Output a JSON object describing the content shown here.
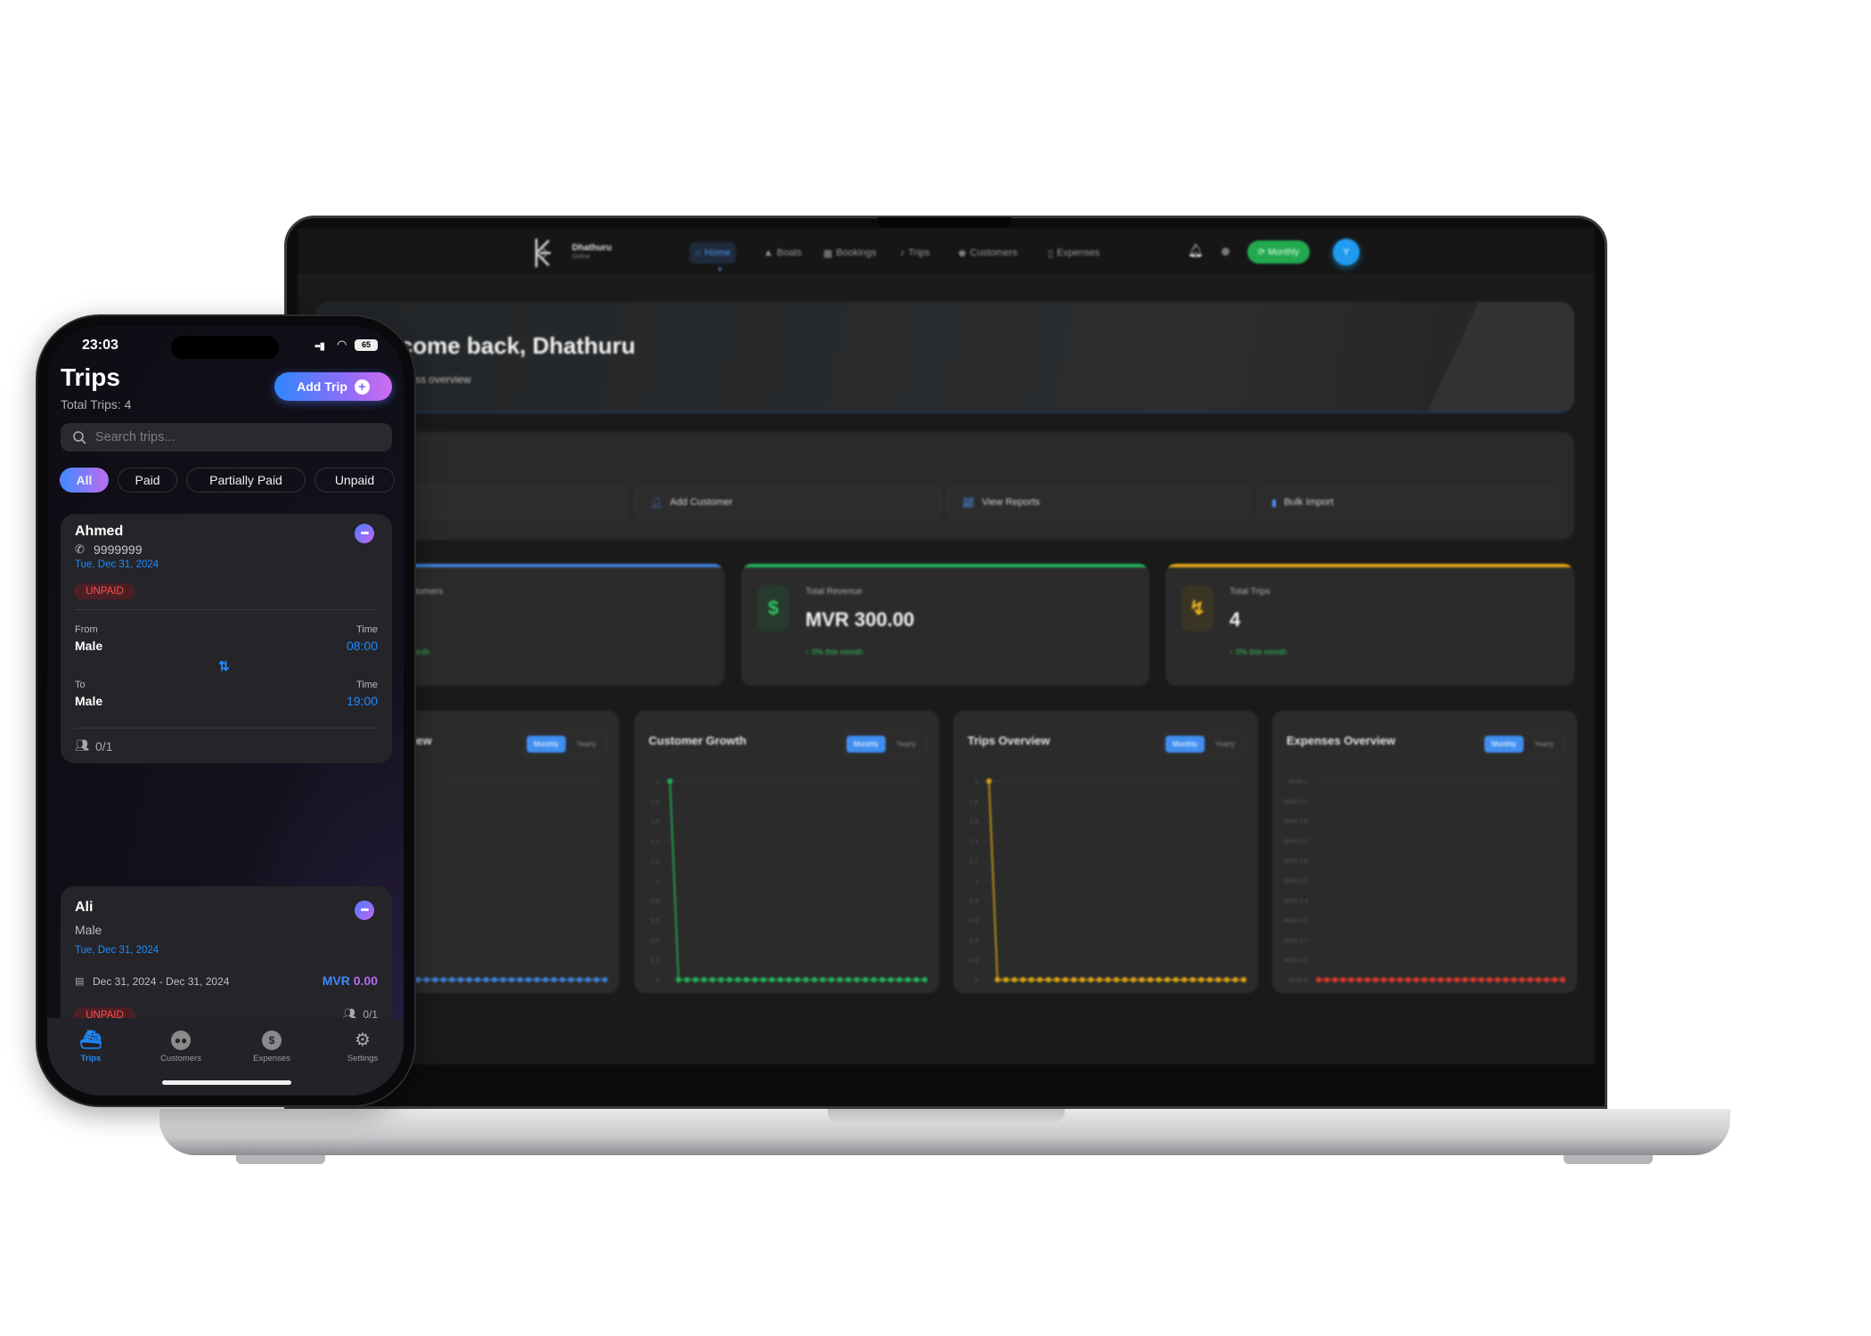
{
  "laptop": {
    "brand": {
      "name": "Dhathuru",
      "sub": "Online"
    },
    "nav": [
      {
        "label": "Home",
        "icon": "home-icon",
        "active": true
      },
      {
        "label": "Boats",
        "icon": "boat-icon"
      },
      {
        "label": "Bookings",
        "icon": "calendar-icon"
      },
      {
        "label": "Trips",
        "icon": "route-icon"
      },
      {
        "label": "Customers",
        "icon": "users-icon"
      },
      {
        "label": "Expenses",
        "icon": "receipt-icon"
      }
    ],
    "header": {
      "period_label": "Monthly",
      "avatar_initial": "Y"
    },
    "welcome": {
      "title": "Welcome back, Dhathuru",
      "subtitle": "Your business overview"
    },
    "quick_actions": [
      {
        "label": "Add Customer",
        "icon": "user-plus-icon"
      },
      {
        "label": "View Reports",
        "icon": "chart-icon"
      },
      {
        "label": "Bulk Import",
        "icon": "file-icon"
      }
    ],
    "stats": [
      {
        "label": "Total Customers",
        "value": "",
        "change": "0% this month",
        "color": "#3f7fd8"
      },
      {
        "label": "Total Revenue",
        "value": "MVR 300.00",
        "change": "↑ 0% this month",
        "color": "#22b357",
        "icon": "dollar-icon"
      },
      {
        "label": "Total Trips",
        "value": "4",
        "change": "↑ 0% this month",
        "color": "#e0a416",
        "icon": "route-icon"
      }
    ],
    "toggle": {
      "monthly": "Monthly",
      "yearly": "Yearly"
    }
  },
  "chart_data": [
    {
      "type": "line",
      "title": "Revenue Overview",
      "color": "#3f7fd8",
      "ylim": [
        0,
        2
      ],
      "yticks": [],
      "values": [
        0,
        0,
        0,
        0,
        0,
        0,
        0,
        0,
        0,
        0,
        0,
        0,
        0,
        0,
        0,
        0,
        0,
        0,
        0,
        0,
        0,
        0,
        0,
        0,
        0,
        0,
        0,
        0,
        0,
        0,
        0
      ],
      "grid": true
    },
    {
      "type": "line",
      "title": "Customer Growth",
      "color": "#22b357",
      "ylim": [
        0,
        2
      ],
      "yticks": [
        "0",
        "0.2",
        "0.4",
        "0.6",
        "0.8",
        "1",
        "1.2",
        "1.4",
        "1.6",
        "1.8",
        "2"
      ],
      "values": [
        2,
        0,
        0,
        0,
        0,
        0,
        0,
        0,
        0,
        0,
        0,
        0,
        0,
        0,
        0,
        0,
        0,
        0,
        0,
        0,
        0,
        0,
        0,
        0,
        0,
        0,
        0,
        0,
        0,
        0,
        0
      ],
      "grid": true
    },
    {
      "type": "line",
      "title": "Trips Overview",
      "color": "#d9a412",
      "ylim": [
        0,
        2
      ],
      "yticks": [
        "0",
        "0.2",
        "0.4",
        "0.6",
        "0.8",
        "1",
        "1.2",
        "1.4",
        "1.6",
        "1.8",
        "2"
      ],
      "values": [
        2,
        0,
        0,
        0,
        0,
        0,
        0,
        0,
        0,
        0,
        0,
        0,
        0,
        0,
        0,
        0,
        0,
        0,
        0,
        0,
        0,
        0,
        0,
        0,
        0,
        0,
        0,
        0,
        0,
        0,
        0
      ],
      "grid": true
    },
    {
      "type": "line",
      "title": "Expenses Overview",
      "color": "#d8392b",
      "ylim": [
        0,
        1
      ],
      "yticks": [
        "MVR 0",
        "MVR 0.1",
        "MVR 0.2",
        "MVR 0.3",
        "MVR 0.4",
        "MVR 0.5",
        "MVR 0.6",
        "MVR 0.7",
        "MVR 0.8",
        "MVR 0.9",
        "MVR 1"
      ],
      "values": [
        0,
        0,
        0,
        0,
        0,
        0,
        0,
        0,
        0,
        0,
        0,
        0,
        0,
        0,
        0,
        0,
        0,
        0,
        0,
        0,
        0,
        0,
        0,
        0,
        0,
        0,
        0,
        0,
        0,
        0,
        0
      ],
      "grid": true
    }
  ],
  "phone": {
    "status": {
      "time": "23:03",
      "battery": "65"
    },
    "title": "Trips",
    "subtitle": "Total Trips: 4",
    "add_button": "Add Trip",
    "search_placeholder": "Search trips...",
    "filters": [
      "All",
      "Paid",
      "Partially Paid",
      "Unpaid"
    ],
    "trips": [
      {
        "name": "Ahmed",
        "phone": "9999999",
        "date": "Tue, Dec 31, 2024",
        "status": "UNPAID",
        "from_label": "From",
        "from": "Male",
        "time_label": "Time",
        "from_time": "08:00",
        "to_label": "To",
        "to": "Male",
        "to_time": "19:00",
        "seats": "0/1"
      },
      {
        "name": "Ali",
        "location": "Male",
        "date": "Tue, Dec 31, 2024",
        "range": "Dec 31, 2024 - Dec 31, 2024",
        "currency": "MVR",
        "amount": "0.00",
        "status": "UNPAID",
        "seats": "0/1"
      }
    ],
    "tabs": [
      {
        "label": "Trips",
        "icon": "ship-icon",
        "active": true
      },
      {
        "label": "Customers",
        "icon": "users-icon"
      },
      {
        "label": "Expenses",
        "icon": "dollar-icon"
      },
      {
        "label": "Settings",
        "icon": "gear-icon"
      }
    ]
  }
}
